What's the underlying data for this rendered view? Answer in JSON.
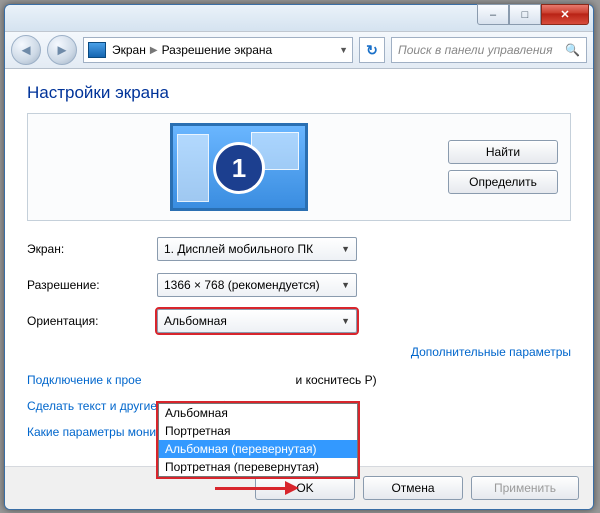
{
  "titlebar": {
    "min_glyph": "–",
    "max_glyph": "□",
    "close_glyph": "✕"
  },
  "toolbar": {
    "back_glyph": "◄",
    "fwd_glyph": "►",
    "crumb1": "Экран",
    "crumb2": "Разрешение экрана",
    "refresh_glyph": "↻",
    "search_placeholder": "Поиск в панели управления",
    "search_glyph": "🔍"
  },
  "page": {
    "title": "Настройки экрана",
    "monitor_number": "1",
    "find_btn": "Найти",
    "detect_btn": "Определить"
  },
  "settings": {
    "display_label": "Экран:",
    "display_value": "1. Дисплей мобильного ПК",
    "resolution_label": "Разрешение:",
    "resolution_value": "1366 × 768 (рекомендуется)",
    "orientation_label": "Ориентация:",
    "orientation_value": "Альбомная",
    "orientation_options": [
      "Альбомная",
      "Портретная",
      "Альбомная (перевернутая)",
      "Портретная (перевернутая)"
    ],
    "orientation_selected_index": 2
  },
  "links": {
    "advanced": "Дополнительные параметры",
    "connect_prefix": "Подключение к прое",
    "connect_suffix": " и коснитесь P)",
    "text_size": "Сделать текст и другие элементы больше или меньше",
    "which_params": "Какие параметры монитора следует выбрать?"
  },
  "footer": {
    "ok": "OK",
    "cancel": "Отмена",
    "apply": "Применить"
  }
}
